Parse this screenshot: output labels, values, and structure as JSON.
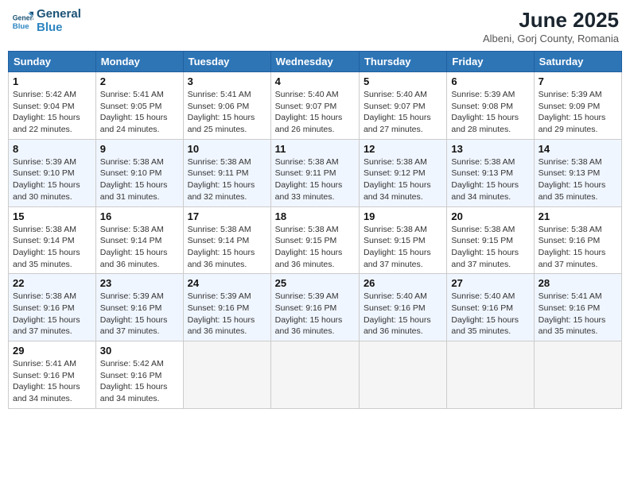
{
  "header": {
    "logo_line1": "General",
    "logo_line2": "Blue",
    "month_year": "June 2025",
    "location": "Albeni, Gorj County, Romania"
  },
  "weekdays": [
    "Sunday",
    "Monday",
    "Tuesday",
    "Wednesday",
    "Thursday",
    "Friday",
    "Saturday"
  ],
  "weeks": [
    [
      {
        "day": "1",
        "info": "Sunrise: 5:42 AM\nSunset: 9:04 PM\nDaylight: 15 hours and 22 minutes."
      },
      {
        "day": "2",
        "info": "Sunrise: 5:41 AM\nSunset: 9:05 PM\nDaylight: 15 hours and 24 minutes."
      },
      {
        "day": "3",
        "info": "Sunrise: 5:41 AM\nSunset: 9:06 PM\nDaylight: 15 hours and 25 minutes."
      },
      {
        "day": "4",
        "info": "Sunrise: 5:40 AM\nSunset: 9:07 PM\nDaylight: 15 hours and 26 minutes."
      },
      {
        "day": "5",
        "info": "Sunrise: 5:40 AM\nSunset: 9:07 PM\nDaylight: 15 hours and 27 minutes."
      },
      {
        "day": "6",
        "info": "Sunrise: 5:39 AM\nSunset: 9:08 PM\nDaylight: 15 hours and 28 minutes."
      },
      {
        "day": "7",
        "info": "Sunrise: 5:39 AM\nSunset: 9:09 PM\nDaylight: 15 hours and 29 minutes."
      }
    ],
    [
      {
        "day": "8",
        "info": "Sunrise: 5:39 AM\nSunset: 9:10 PM\nDaylight: 15 hours and 30 minutes."
      },
      {
        "day": "9",
        "info": "Sunrise: 5:38 AM\nSunset: 9:10 PM\nDaylight: 15 hours and 31 minutes."
      },
      {
        "day": "10",
        "info": "Sunrise: 5:38 AM\nSunset: 9:11 PM\nDaylight: 15 hours and 32 minutes."
      },
      {
        "day": "11",
        "info": "Sunrise: 5:38 AM\nSunset: 9:11 PM\nDaylight: 15 hours and 33 minutes."
      },
      {
        "day": "12",
        "info": "Sunrise: 5:38 AM\nSunset: 9:12 PM\nDaylight: 15 hours and 34 minutes."
      },
      {
        "day": "13",
        "info": "Sunrise: 5:38 AM\nSunset: 9:13 PM\nDaylight: 15 hours and 34 minutes."
      },
      {
        "day": "14",
        "info": "Sunrise: 5:38 AM\nSunset: 9:13 PM\nDaylight: 15 hours and 35 minutes."
      }
    ],
    [
      {
        "day": "15",
        "info": "Sunrise: 5:38 AM\nSunset: 9:14 PM\nDaylight: 15 hours and 35 minutes."
      },
      {
        "day": "16",
        "info": "Sunrise: 5:38 AM\nSunset: 9:14 PM\nDaylight: 15 hours and 36 minutes."
      },
      {
        "day": "17",
        "info": "Sunrise: 5:38 AM\nSunset: 9:14 PM\nDaylight: 15 hours and 36 minutes."
      },
      {
        "day": "18",
        "info": "Sunrise: 5:38 AM\nSunset: 9:15 PM\nDaylight: 15 hours and 36 minutes."
      },
      {
        "day": "19",
        "info": "Sunrise: 5:38 AM\nSunset: 9:15 PM\nDaylight: 15 hours and 37 minutes."
      },
      {
        "day": "20",
        "info": "Sunrise: 5:38 AM\nSunset: 9:15 PM\nDaylight: 15 hours and 37 minutes."
      },
      {
        "day": "21",
        "info": "Sunrise: 5:38 AM\nSunset: 9:16 PM\nDaylight: 15 hours and 37 minutes."
      }
    ],
    [
      {
        "day": "22",
        "info": "Sunrise: 5:38 AM\nSunset: 9:16 PM\nDaylight: 15 hours and 37 minutes."
      },
      {
        "day": "23",
        "info": "Sunrise: 5:39 AM\nSunset: 9:16 PM\nDaylight: 15 hours and 37 minutes."
      },
      {
        "day": "24",
        "info": "Sunrise: 5:39 AM\nSunset: 9:16 PM\nDaylight: 15 hours and 36 minutes."
      },
      {
        "day": "25",
        "info": "Sunrise: 5:39 AM\nSunset: 9:16 PM\nDaylight: 15 hours and 36 minutes."
      },
      {
        "day": "26",
        "info": "Sunrise: 5:40 AM\nSunset: 9:16 PM\nDaylight: 15 hours and 36 minutes."
      },
      {
        "day": "27",
        "info": "Sunrise: 5:40 AM\nSunset: 9:16 PM\nDaylight: 15 hours and 35 minutes."
      },
      {
        "day": "28",
        "info": "Sunrise: 5:41 AM\nSunset: 9:16 PM\nDaylight: 15 hours and 35 minutes."
      }
    ],
    [
      {
        "day": "29",
        "info": "Sunrise: 5:41 AM\nSunset: 9:16 PM\nDaylight: 15 hours and 34 minutes."
      },
      {
        "day": "30",
        "info": "Sunrise: 5:42 AM\nSunset: 9:16 PM\nDaylight: 15 hours and 34 minutes."
      },
      {
        "day": "",
        "info": ""
      },
      {
        "day": "",
        "info": ""
      },
      {
        "day": "",
        "info": ""
      },
      {
        "day": "",
        "info": ""
      },
      {
        "day": "",
        "info": ""
      }
    ]
  ]
}
